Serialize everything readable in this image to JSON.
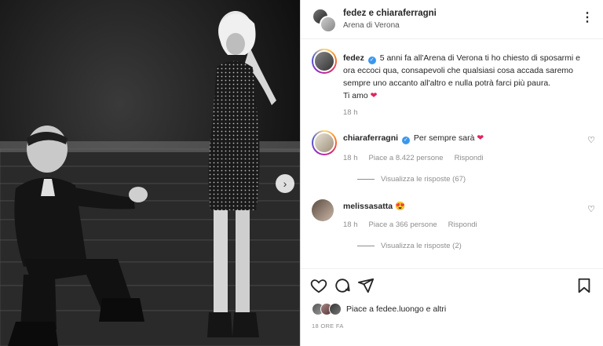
{
  "header": {
    "title": "fedez e chiaraferragni",
    "location": "Arena di Verona",
    "more_icon": "more-horizontal-icon"
  },
  "caption": {
    "username": "fedez",
    "text": "5 anni fa all'Arena di Verona ti ho chiesto di sposarmi e ora eccoci qua, consapevoli che qualsiasi cosa accada saremo sempre uno accanto all'altro e nulla potrà farci più paura.",
    "closing": "Ti amo",
    "emoji": "❤",
    "time": "18 h"
  },
  "comments": [
    {
      "username": "chiaraferragni",
      "text": "Per sempre sarà",
      "emoji": "❤",
      "time": "18 h",
      "likes": "Piace a 8.422 persone",
      "reply": "Rispondi",
      "replies": "Visualizza le risposte (67)"
    },
    {
      "username": "melissasatta",
      "text": "",
      "emoji": "😍",
      "time": "18 h",
      "likes": "Piace a 366 persone",
      "reply": "Rispondi",
      "replies": "Visualizza le risposte (2)"
    }
  ],
  "likes_text": "Piace a fedee.luongo e altri",
  "date": "18 ORE FA",
  "colors": {
    "verified": "#3897f0",
    "heart": "#e0245e",
    "muted": "#8e8e8e"
  }
}
